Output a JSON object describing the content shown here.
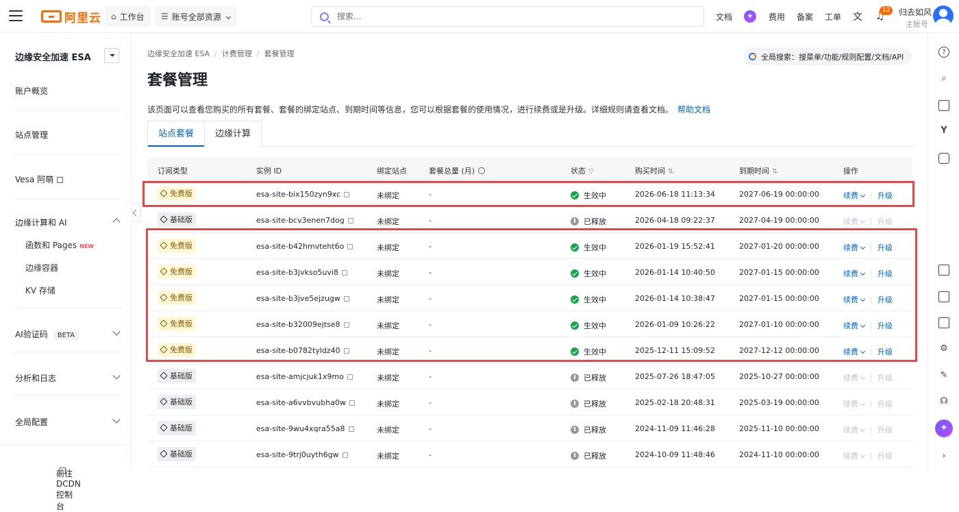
{
  "topbar": {
    "logo_text": "阿里云",
    "workbench": "工作台",
    "resource_scope": "账号全部资源",
    "search_placeholder": "搜索...",
    "links": {
      "docs": "文档",
      "billing": "费用",
      "icp": "备案",
      "ticket": "工单"
    },
    "notification_count": "12",
    "user_name": "归去如风",
    "account_type": "主账号",
    "brand_color": "#ff6a00"
  },
  "sidebar": {
    "title": "边缘安全加速 ESA",
    "items": {
      "overview": "账户概览",
      "sites": "站点管理",
      "vesa": "Vesa 阿萌",
      "edge_ai": "边缘计算和 AI",
      "functions": "函数和 Pages",
      "new_badge": "NEW",
      "containers": "边缘容器",
      "kv": "KV 存储",
      "captcha": "AI验证码",
      "beta_badge": "BETA",
      "analytics": "分析和日志",
      "global": "全局配置"
    },
    "footer": "前往 DCDN 控制台"
  },
  "breadcrumb": [
    "边缘安全加速 ESA",
    "计费管理",
    "套餐管理"
  ],
  "global_search": "全局搜索：搜菜单/功能/规则配置/文档/API",
  "page_title": "套餐管理",
  "description": "该页面可以查看您购买的所有套餐、套餐的绑定站点、到期时间等信息，您可以根据套餐的使用情况，进行续费或是升级。详细规则请查看文档。",
  "help_link": "帮助文档",
  "tabs": [
    "站点套餐",
    "边缘计算"
  ],
  "table": {
    "headers": {
      "plan": "订阅类型",
      "instance": "实例 ID",
      "site": "绑定站点",
      "quota": "套餐总量 (月)",
      "status": "状态",
      "purchase": "购买时间",
      "expire": "到期时间",
      "actions": "操作"
    },
    "renew_label": "续费",
    "upgrade_label": "升级",
    "rows": [
      {
        "plan": "免费版",
        "id": "esa-site-bix150zyn9xc",
        "site": "未绑定",
        "quota": "-",
        "status": "生效中",
        "purchase": "2026-06-18 11:13:34",
        "expire": "2027-06-19 00:00:00"
      },
      {
        "plan": "基础版",
        "id": "esa-site-bcv3enen7dog",
        "site": "未绑定",
        "quota": "-",
        "status": "已释放",
        "purchase": "2026-04-18 09:22:37",
        "expire": "2027-04-19 00:00:00"
      },
      {
        "plan": "免费版",
        "id": "esa-site-b42hmvteht6o",
        "site": "未绑定",
        "quota": "-",
        "status": "生效中",
        "purchase": "2026-01-19 15:52:41",
        "expire": "2027-01-20 00:00:00"
      },
      {
        "plan": "免费版",
        "id": "esa-site-b3jvkso5uvi8",
        "site": "未绑定",
        "quota": "-",
        "status": "生效中",
        "purchase": "2026-01-14 10:40:50",
        "expire": "2027-01-15 00:00:00"
      },
      {
        "plan": "免费版",
        "id": "esa-site-b3jve5ejzugw",
        "site": "未绑定",
        "quota": "-",
        "status": "生效中",
        "purchase": "2026-01-14 10:38:47",
        "expire": "2027-01-15 00:00:00"
      },
      {
        "plan": "免费版",
        "id": "esa-site-b32009ejtse8",
        "site": "未绑定",
        "quota": "-",
        "status": "生效中",
        "purchase": "2026-01-09 10:26:22",
        "expire": "2027-01-10 00:00:00"
      },
      {
        "plan": "免费版",
        "id": "esa-site-b0782tyldz40",
        "site": "未绑定",
        "quota": "-",
        "status": "生效中",
        "purchase": "2025-12-11 15:09:52",
        "expire": "2027-12-12 00:00:00"
      },
      {
        "plan": "基础版",
        "id": "esa-site-amjcjuk1x9mo",
        "site": "未绑定",
        "quota": "-",
        "status": "已释放",
        "purchase": "2025-07-26 18:47:05",
        "expire": "2025-10-27 00:00:00"
      },
      {
        "plan": "基础版",
        "id": "esa-site-a6vvbvubha0w",
        "site": "未绑定",
        "quota": "-",
        "status": "已释放",
        "purchase": "2025-02-18 20:48:31",
        "expire": "2025-03-19 00:00:00"
      },
      {
        "plan": "基础版",
        "id": "esa-site-9wu4xqra55a8",
        "site": "未绑定",
        "quota": "-",
        "status": "已释放",
        "purchase": "2024-11-09 11:46:28",
        "expire": "2025-11-10 00:00:00"
      },
      {
        "plan": "基础版",
        "id": "esa-site-9trj0uyth6gw",
        "site": "未绑定",
        "quota": "-",
        "status": "已释放",
        "purchase": "2024-10-09 11:48:46",
        "expire": "2024-11-10 00:00:00"
      }
    ]
  },
  "colors": {
    "link": "#0064c8",
    "active_status": "#17a34a",
    "highlight_box": "#e84545"
  }
}
